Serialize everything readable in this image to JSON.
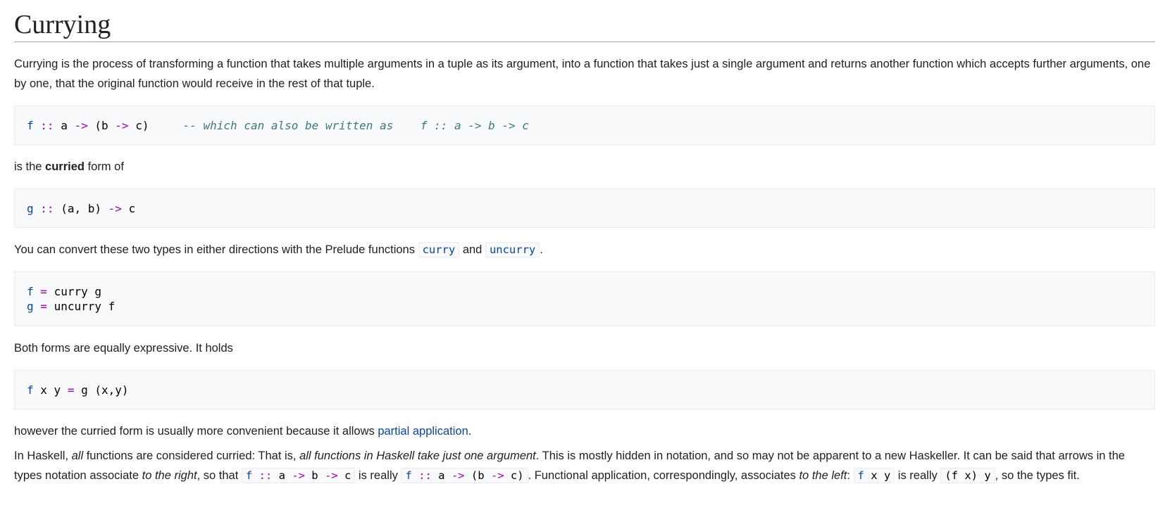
{
  "page_title": "Currying",
  "intro": "Currying is the process of transforming a function that takes multiple arguments in a tuple as its argument, into a function that takes just a single argument and returns another function which accepts further arguments, one by one, that the original function would receive in the rest of that tuple.",
  "code1": {
    "f": "f",
    "colons": "::",
    "a": "a",
    "arrow1": "->",
    "paren_b": "(b",
    "arrow2": "->",
    "c_paren": "c)",
    "comment": "-- which can also be written as    f :: a -> b -> c"
  },
  "curried_sentence": {
    "before": "is the ",
    "bold": "curried",
    "after": " form of"
  },
  "code2": {
    "g": "g",
    "colons": "::",
    "tuple": "(a, b)",
    "arrow": "->",
    "c": "c"
  },
  "convert_sentence": {
    "before": "You can convert these two types in either directions with the Prelude functions ",
    "link1": "curry",
    "middle": " and ",
    "link2": "uncurry",
    "after": "."
  },
  "code3": {
    "line1": {
      "name": "f",
      "eq": "=",
      "rest": "curry g"
    },
    "line2": {
      "name": "g",
      "eq": "=",
      "rest": "uncurry f"
    }
  },
  "holds_sentence": "Both forms are equally expressive. It holds",
  "code4": {
    "f": "f",
    "xy": "x y",
    "eq": "=",
    "rest": "g (x,y)"
  },
  "convenient_sentence": {
    "before": "however the curried form is usually more convenient because it allows ",
    "link": "partial application",
    "after": "."
  },
  "haskell_paragraph": {
    "t1": "In Haskell, ",
    "i1": "all",
    "t2": " functions are considered curried: That is, ",
    "i2": "all functions in Haskell take just one argument",
    "t3": ". This is mostly hidden in notation, and so may not be apparent to a new Haskeller. It can be said that arrows in the types notation associate ",
    "i3": "to the right",
    "t4": ", so that ",
    "c1": {
      "f": "f",
      "colons": "::",
      "a": "a",
      "arrow1": "->",
      "b": "b",
      "arrow2": "->",
      "c": "c"
    },
    "t5": " is really ",
    "c2": {
      "f": "f",
      "colons": "::",
      "a": "a",
      "arrow1": "->",
      "paren_b": "(b",
      "arrow2": "->",
      "c_paren": "c)"
    },
    "t6": ". Functional application, correspondingly, associates ",
    "i4": "to the left",
    "t7": ": ",
    "c3": {
      "f": "f",
      "rest": "x y"
    },
    "t8": " is really ",
    "c4": "(f x) y",
    "t9": ", so the types fit."
  },
  "colors": {
    "link": "#0645ad",
    "operator": "#a000c8",
    "comment": "#3a7a7a",
    "text": "#202122"
  }
}
